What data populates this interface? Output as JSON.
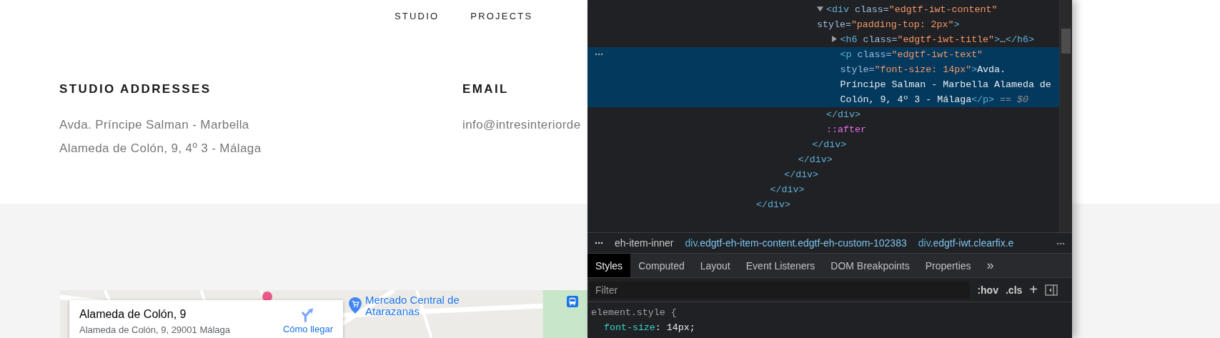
{
  "page": {
    "nav": [
      {
        "label": "STUDIO"
      },
      {
        "label": "PROJECTS"
      }
    ],
    "contact": [
      {
        "heading": "STUDIO ADDRESSES",
        "lines": [
          "Avda. Príncipe Salman - Marbella",
          "Alameda de Colón, 9, 4º 3 - Málaga"
        ]
      },
      {
        "heading": "EMAIL",
        "lines": [
          "info@intresinteriorde"
        ]
      }
    ],
    "map": {
      "place_card": {
        "title": "Alameda de Colón, 9",
        "address": "Alameda de Colón, 9, 29001 Málaga",
        "directions_link": "Cómo llegar"
      },
      "labels": [
        {
          "text": "Mercado Central de Atarazanas"
        }
      ]
    }
  },
  "devtools": {
    "elements": [
      {
        "close": [
          {
            "kind": "tag",
            "text": "</div>"
          }
        ],
        "children": [
          {
            "close": [
              {
                "kind": "tag",
                "text": "</div>"
              }
            ],
            "children": [
              {
                "close": [
                  {
                    "kind": "tag",
                    "text": "</div>"
                  }
                ],
                "children": [
                  {
                    "close": [
                      {
                        "kind": "tag",
                        "text": "</div>"
                      }
                    ],
                    "children": [
                      {
                        "close": [
                          {
                            "kind": "tag",
                            "text": "</div>"
                          }
                        ],
                        "children": [
                          {
                            "expanded": true,
                            "selected": false,
                            "open": [
                              {
                                "kind": "tag",
                                "text": "<div"
                              },
                              {
                                "kind": "attr",
                                "text": " class="
                              },
                              {
                                "kind": "value",
                                "text": "\"edgtf-iwt-content\""
                              },
                              {
                                "kind": "attr",
                                "text": " style="
                              },
                              {
                                "kind": "value",
                                "text": "\"padding-top: 2px\""
                              },
                              {
                                "kind": "tag",
                                "text": ">"
                              }
                            ],
                            "close": [
                              {
                                "kind": "tag",
                                "text": "</div>"
                              }
                            ],
                            "children": [
                              {
                                "expanded": false,
                                "selected": false,
                                "open": [
                                  {
                                    "kind": "tag",
                                    "text": "<h6"
                                  },
                                  {
                                    "kind": "attr",
                                    "text": " class="
                                  },
                                  {
                                    "kind": "value",
                                    "text": "\"edgtf-iwt-title\""
                                  },
                                  {
                                    "kind": "tag",
                                    "text": ">"
                                  },
                                  {
                                    "kind": "text",
                                    "text": "…"
                                  },
                                  {
                                    "kind": "tag",
                                    "text": "</h6>"
                                  }
                                ]
                              },
                              {
                                "selected": true,
                                "open": [
                                  {
                                    "kind": "tag",
                                    "text": "<p"
                                  },
                                  {
                                    "kind": "attr",
                                    "text": " class="
                                  },
                                  {
                                    "kind": "value",
                                    "text": "\"edgtf-iwt-text\""
                                  },
                                  {
                                    "kind": "attr",
                                    "text": " style="
                                  },
                                  {
                                    "kind": "value",
                                    "text": "\"font-size: 14px\""
                                  },
                                  {
                                    "kind": "tag",
                                    "text": ">"
                                  },
                                  {
                                    "kind": "text",
                                    "text": "Avda. Príncipe Salman - Marbella Alameda de Colón, 9, 4º 3 - Málaga"
                                  },
                                  {
                                    "kind": "tag",
                                    "text": "</p>"
                                  },
                                  {
                                    "kind": "comment",
                                    "text": " == $0"
                                  }
                                ]
                              }
                            ]
                          },
                          {
                            "selected": false,
                            "open": [
                              {
                                "kind": "pseudo",
                                "text": "::after"
                              }
                            ]
                          }
                        ]
                      }
                    ]
                  }
                ]
              }
            ]
          }
        ]
      }
    ],
    "breadcrumbs": [
      {
        "classes": "eh-item-inner"
      },
      {
        "tag": "div",
        "classes": ".edgtf-eh-item-content.edgtf-eh-custom-102383"
      },
      {
        "tag": "div",
        "classes": ".edgtf-iwt.clearfix.e"
      }
    ],
    "tabs": [
      {
        "label": "Styles",
        "selected": true
      },
      {
        "label": "Computed",
        "selected": false
      },
      {
        "label": "Layout",
        "selected": false
      },
      {
        "label": "Event Listeners",
        "selected": false
      },
      {
        "label": "DOM Breakpoints",
        "selected": false
      },
      {
        "label": "Properties",
        "selected": false
      }
    ],
    "more_tabs": "»",
    "filter": {
      "placeholder": "Filter"
    },
    "filter_buttons": [
      ":hov",
      ".cls",
      "+"
    ],
    "styles": [
      {
        "selector": "element.style",
        "brace": "{",
        "declarations": [
          {
            "name": "font-size",
            "colon": ":",
            "value": "14px;"
          }
        ]
      }
    ]
  }
}
